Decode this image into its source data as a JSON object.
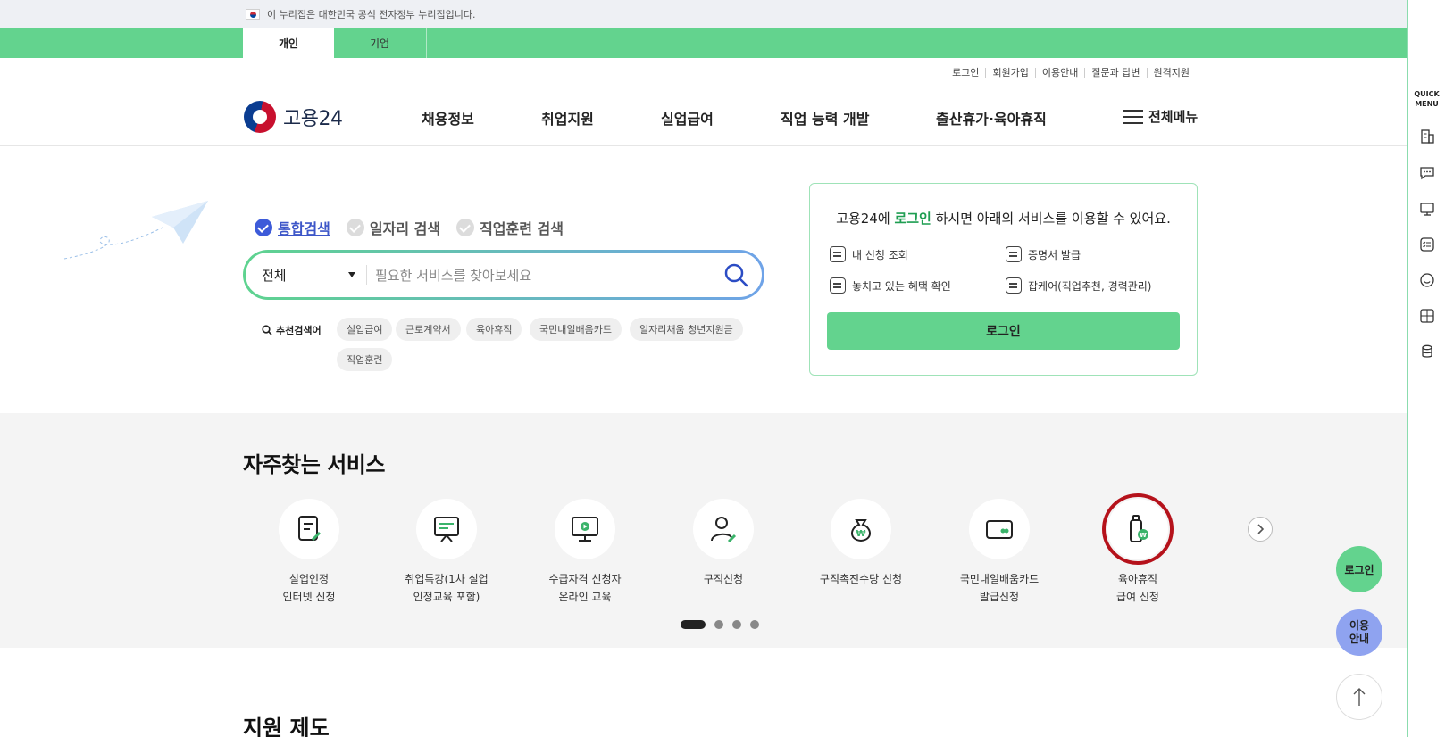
{
  "gov_banner": {
    "text": "이 누리집은 대한민국 공식 전자정부 누리집입니다."
  },
  "tabs": [
    {
      "label": "개인"
    },
    {
      "label": "기업"
    }
  ],
  "util_links": [
    "로그인",
    "회원가입",
    "이용안내",
    "질문과 답변",
    "원격지원"
  ],
  "logo": {
    "text": "고용24"
  },
  "gnb": [
    "채용정보",
    "취업지원",
    "실업급여",
    "직업 능력 개발",
    "출산휴가·육아휴직"
  ],
  "all_menu": "전체메뉴",
  "search": {
    "tabs": [
      "통합검색",
      "일자리 검색",
      "직업훈련 검색"
    ],
    "category": "전체",
    "placeholder": "필요한 서비스를 찾아보세요",
    "recommended_label": "추천검색어",
    "keywords": [
      "실업급여",
      "근로계약서",
      "육아휴직",
      "국민내일배움카드",
      "일자리채움 청년지원금",
      "직업훈련"
    ]
  },
  "login_card": {
    "title_prefix": "고용24에",
    "title_highlight": "로그인",
    "title_suffix": "하시면 아래의 서비스를 이용할 수 있어요.",
    "items": [
      "내 신청 조회",
      "증명서 발급",
      "놓치고 있는 혜택 확인",
      "잡케어(직업추천, 경력관리)"
    ],
    "button": "로그인"
  },
  "frequent": {
    "title": "자주찾는 서비스",
    "services": [
      {
        "line1": "실업인정",
        "line2": "인터넷 신청",
        "icon": "document-edit-icon"
      },
      {
        "line1": "취업특강(1차 실업",
        "line2": "인정교육 포함)",
        "icon": "presentation-board-icon"
      },
      {
        "line1": "수급자격 신청자",
        "line2": "온라인 교육",
        "icon": "monitor-play-icon"
      },
      {
        "line1": "구직신청",
        "line2": "",
        "icon": "person-edit-icon"
      },
      {
        "line1": "구직촉진수당 신청",
        "line2": "",
        "icon": "money-bag-icon"
      },
      {
        "line1": "국민내일배움카드",
        "line2": "발급신청",
        "icon": "card-icon"
      },
      {
        "line1": "육아휴직",
        "line2": "급여 신청",
        "icon": "baby-bottle-icon"
      }
    ]
  },
  "support": {
    "title": "지원 제도"
  },
  "quick_menu": {
    "title_line1": "QUICK",
    "title_line2": "MENU"
  },
  "floating": {
    "login": "로그인",
    "guide_line1": "이용",
    "guide_line2": "안내"
  }
}
